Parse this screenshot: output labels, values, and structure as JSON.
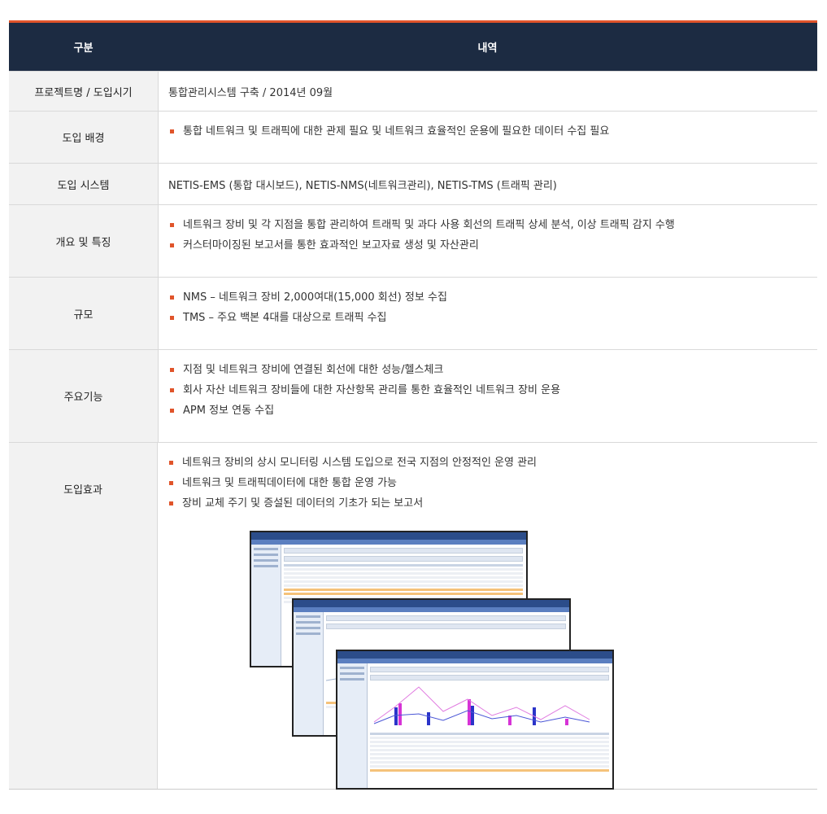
{
  "header": {
    "col1": "구분",
    "col2": "내역"
  },
  "rows": {
    "project": {
      "label": "프로젝트명 / 도입시기",
      "value": "통합관리시스템 구축 / 2014년 09월"
    },
    "background": {
      "label": "도입 배경",
      "items": [
        "통합 네트워크 및 트래픽에 대한 관제 필요 및 네트워크 효율적인 운용에 필요한 데이터 수집 필요"
      ]
    },
    "system": {
      "label": "도입 시스템",
      "value": "NETIS-EMS (통합 대시보드), NETIS-NMS(네트워크관리), NETIS-TMS (트래픽 관리)"
    },
    "overview": {
      "label": "개요 및 특징",
      "items": [
        "네트워크 장비 및 각 지점을 통합 관리하여 트래픽 및 과다 사용 회선의 트래픽 상세 분석, 이상 트래픽 감지 수행",
        "커스터마이징된 보고서를 통한 효과적인 보고자료 생성 및 자산관리"
      ]
    },
    "scale": {
      "label": "규모",
      "items": [
        "NMS – 네트워크 장비 2,000여대(15,000 회선) 정보 수집",
        "TMS – 주요 백본 4대를 대상으로 트래픽 수집"
      ]
    },
    "functions": {
      "label": "주요기능",
      "items": [
        "지점 및 네트워크 장비에 연결된 회선에 대한 성능/헬스체크",
        "회사 자산 네트워크 장비들에 대한 자산항목 관리를 통한 효율적인 네트워크 장비 운용",
        "APM 정보 연동 수집"
      ]
    },
    "effects": {
      "label": "도입효과",
      "items": [
        "네트워크 장비의 상시 모니터링 시스템 도입으로 전국 지점의 안정적인 운영 관리",
        "네트워크 및 트래픽데이터에 대한 통합 운영 가능",
        "장비 교체 주기 및 증설된 데이터의 기초가 되는 보고서"
      ]
    }
  },
  "colors": {
    "header_bg": "#1c2b42",
    "accent": "#e0542a",
    "label_bg": "#f2f2f2"
  }
}
